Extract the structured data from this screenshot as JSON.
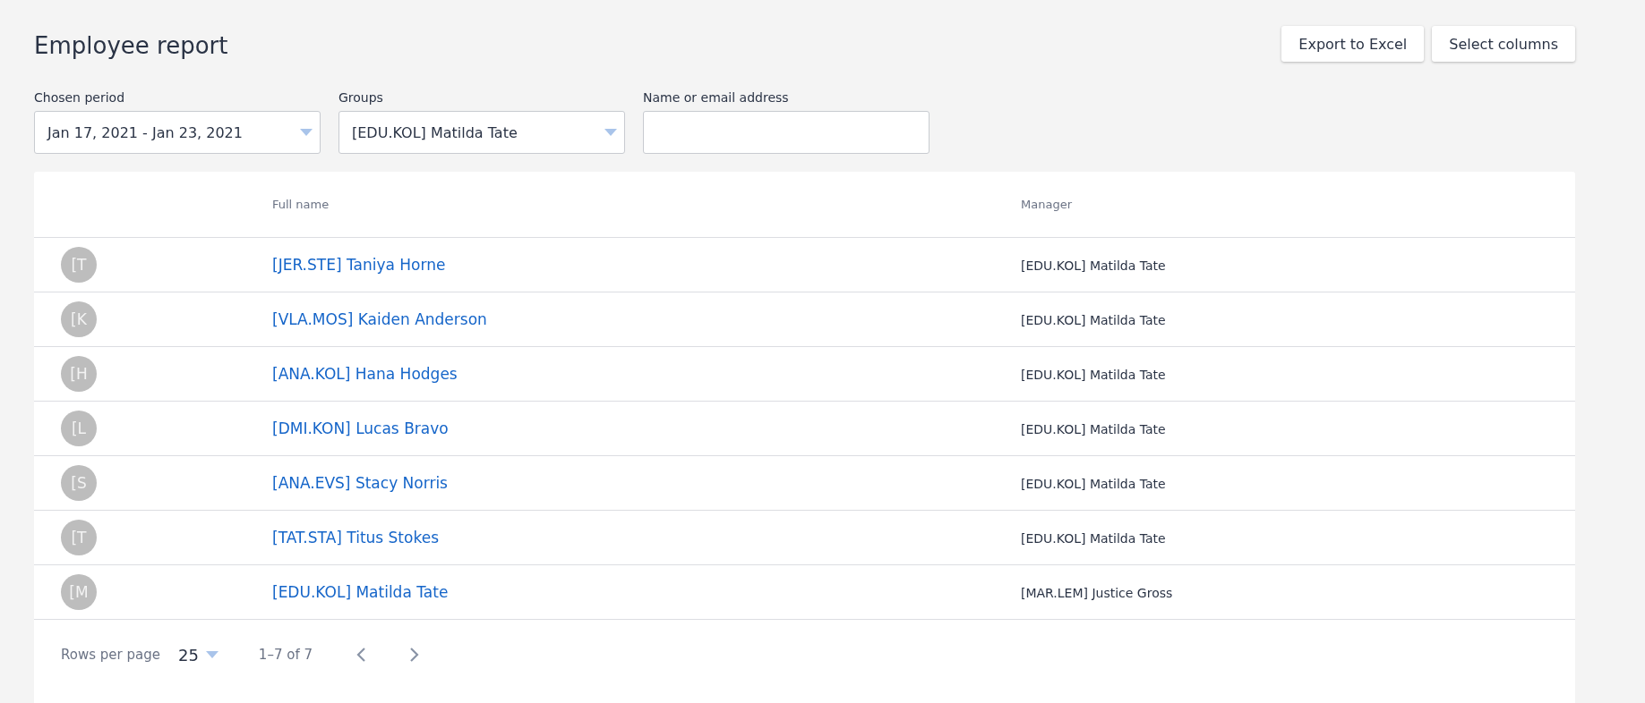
{
  "title": "Employee report",
  "actions": [
    "Export to Excel",
    "Select columns"
  ],
  "filters": [
    {
      "label": "Chosen period",
      "kind": "select",
      "value": "Jan 17, 2021 - Jan 23, 2021"
    },
    {
      "label": "Groups",
      "kind": "select",
      "value": "[EDU.KOL] Matilda Tate"
    },
    {
      "label": "Name or email address",
      "kind": "text"
    }
  ],
  "table": {
    "columns": [
      "Full name",
      "Manager"
    ],
    "rows": [
      {
        "initial": "[T",
        "name": "[JER.STE] Taniya Horne",
        "manager": "[EDU.KOL] Matilda Tate"
      },
      {
        "initial": "[K",
        "name": "[VLA.MOS] Kaiden Anderson",
        "manager": "[EDU.KOL] Matilda Tate"
      },
      {
        "initial": "[H",
        "name": "[ANA.KOL] Hana Hodges",
        "manager": "[EDU.KOL] Matilda Tate"
      },
      {
        "initial": "[L",
        "name": "[DMI.KON] Lucas Bravo",
        "manager": "[EDU.KOL] Matilda Tate"
      },
      {
        "initial": "[S",
        "name": "[ANA.EVS] Stacy Norris",
        "manager": "[EDU.KOL] Matilda Tate"
      },
      {
        "initial": "[T",
        "name": "[TAT.STA] Titus Stokes",
        "manager": "[EDU.KOL] Matilda Tate"
      },
      {
        "initial": "[M",
        "name": "[EDU.KOL] Matilda Tate",
        "manager": "[MAR.LEM] Justice Gross"
      }
    ]
  },
  "pagination": {
    "rows_per_page_label": "Rows per page",
    "rows_per_page": "25",
    "range": "1–7 of 7"
  }
}
